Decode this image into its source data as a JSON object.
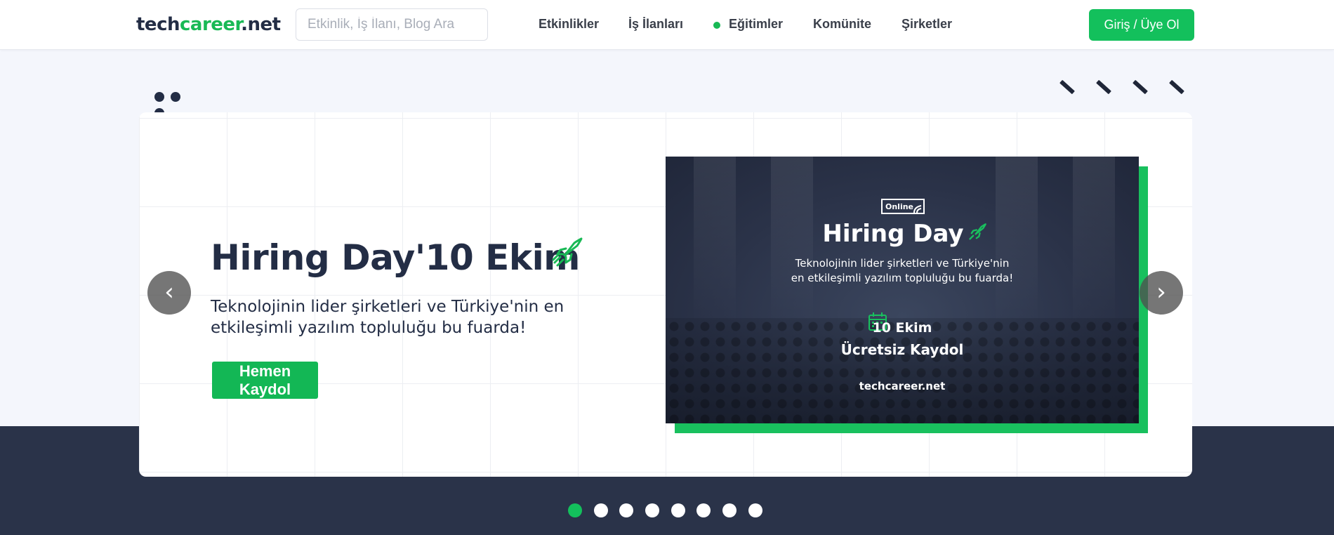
{
  "header": {
    "logo": {
      "part1": "tech",
      "part2": "career",
      "part3": ".net"
    },
    "search": {
      "placeholder": "Etkinlik, İş İlanı, Blog Ara",
      "value": ""
    },
    "nav": [
      {
        "label": "Etkinlikler"
      },
      {
        "label": "İş İlanları"
      },
      {
        "label": "Eğitimler"
      },
      {
        "label": "Komünite"
      },
      {
        "label": "Şirketler"
      }
    ],
    "login_label": "Giriş / Üye Ol"
  },
  "slide": {
    "title": "Hiring Day'10 Ekim",
    "description": "Teknolojinin lider şirketleri ve Türkiye'nin en etkileşimli yazılım topluluğu bu fuarda!",
    "cta_label": "Hemen Kaydol",
    "banner": {
      "badge": "Online",
      "title": "Hiring Day",
      "desc_line1": "Teknolojinin lider şirketleri ve Türkiye'nin",
      "desc_line2": "en etkileşimli yazılım topluluğu bu fuarda!",
      "date": "10 Ekim",
      "register": "Ücretsiz Kaydol",
      "site": "techcareer.net"
    }
  },
  "carousel": {
    "prev_symbol": "‹",
    "next_symbol": "›",
    "slide_count": 8,
    "active_index": 0
  },
  "colors": {
    "brand_green": "#13c05c",
    "navy": "#232d45",
    "dark_band": "#2a3349"
  },
  "icons": [
    "rocket-icon",
    "calendar-icon",
    "wifi-icon",
    "chevron-left-icon",
    "chevron-right-icon"
  ]
}
